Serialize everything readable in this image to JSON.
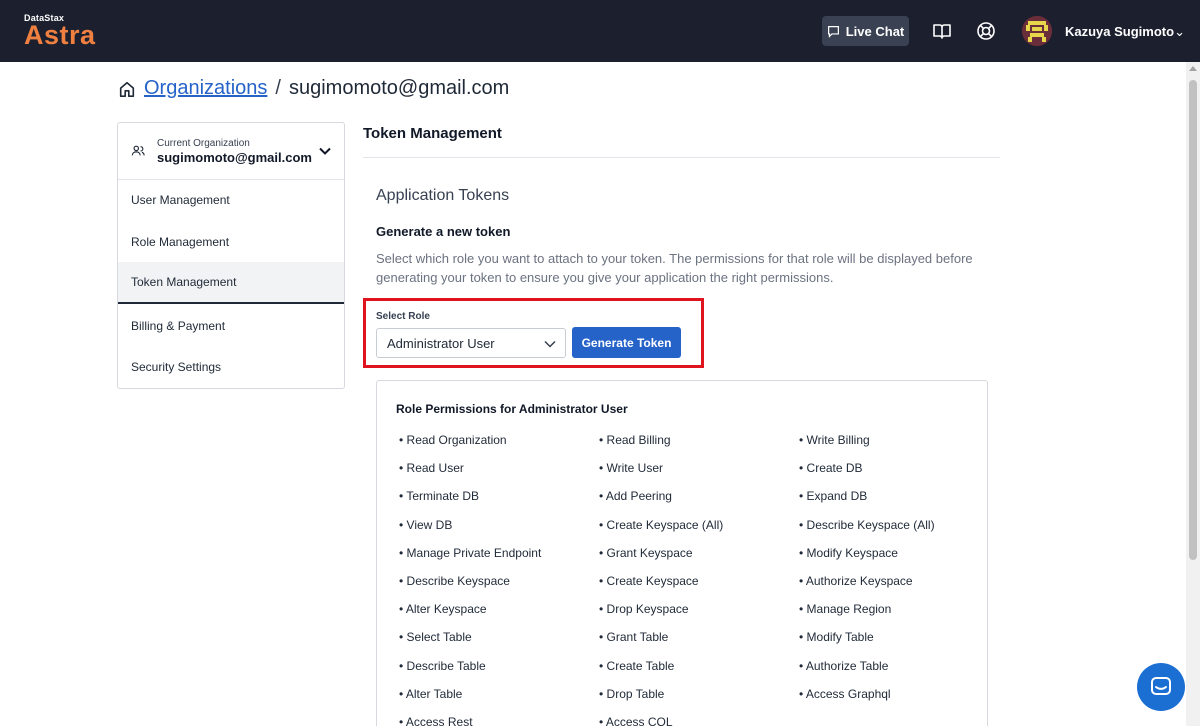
{
  "topbar": {
    "logo_small": "DataStax",
    "logo_big": "Astra",
    "live_chat_label": "Live Chat",
    "user_name": "Kazuya Sugimoto",
    "user_chevron": "⌄"
  },
  "breadcrumb": {
    "link": "Organizations",
    "separator": "/",
    "current": "sugimomoto@gmail.com"
  },
  "sidebar": {
    "org_label": "Current Organization",
    "org_value": "sugimomoto@gmail.com",
    "items": [
      {
        "label": "User Management"
      },
      {
        "label": "Role Management"
      },
      {
        "label": "Token Management"
      },
      {
        "label": "Billing & Payment"
      },
      {
        "label": "Security Settings"
      }
    ]
  },
  "main": {
    "title": "Token Management",
    "section_title": "Application Tokens",
    "gen_title": "Generate a new token",
    "gen_desc": "Select which role you want to attach to your token. The permissions for that role will be displayed before generating your token to ensure you give your application the right permissions.",
    "select_label": "Select Role",
    "select_value": "Administrator User",
    "generate_label": "Generate Token",
    "perm_title": "Role Permissions for Administrator User",
    "permissions": [
      "• Read Organization",
      "• Read Billing",
      "• Write Billing",
      "• Read User",
      "• Write User",
      "• Create DB",
      "• Terminate DB",
      "• Add Peering",
      "• Expand DB",
      "• View DB",
      "• Create Keyspace (All)",
      "• Describe Keyspace (All)",
      "• Manage Private Endpoint",
      "• Grant Keyspace",
      "• Modify Keyspace",
      "• Describe Keyspace",
      "• Create Keyspace",
      "• Authorize Keyspace",
      "• Alter Keyspace",
      "• Drop Keyspace",
      "• Manage Region",
      "• Select Table",
      "• Grant Table",
      "• Modify Table",
      "• Describe Table",
      "• Create Table",
      "• Authorize Table",
      "• Alter Table",
      "• Drop Table",
      "• Access Graphql",
      "• Access Rest",
      "• Access CQL"
    ]
  },
  "icons": {
    "home": "home-icon",
    "live_chat": "chat-icon",
    "docs": "book-icon",
    "help": "lifebuoy-icon",
    "org": "users-icon",
    "chevron": "chevron-down-icon",
    "messenger": "messenger-icon"
  },
  "colors": {
    "topbar": "#1b1f2e",
    "accent": "#2563c9",
    "logo": "#f08040",
    "highlight": "#e0141e"
  }
}
